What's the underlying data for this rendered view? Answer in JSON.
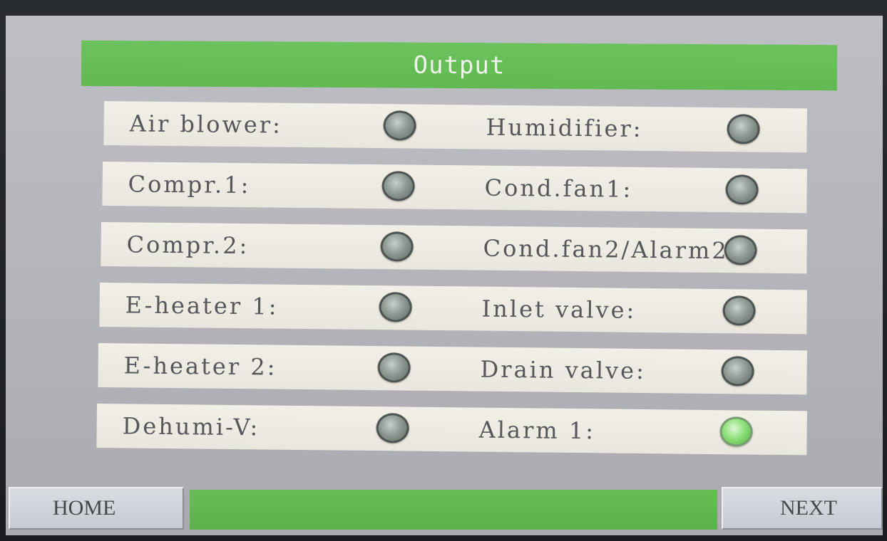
{
  "screen": {
    "title": "Output"
  },
  "rows": [
    {
      "left": {
        "label": "Air blower:",
        "on": false
      },
      "right": {
        "label": "Humidifier:",
        "on": false
      }
    },
    {
      "left": {
        "label": "Compr.1:",
        "on": false
      },
      "right": {
        "label": "Cond.fan1:",
        "on": false
      }
    },
    {
      "left": {
        "label": "Compr.2:",
        "on": false
      },
      "right": {
        "label": "Cond.fan2/Alarm2",
        "on": false
      }
    },
    {
      "left": {
        "label": "E-heater 1:",
        "on": false
      },
      "right": {
        "label": "Inlet valve:",
        "on": false
      }
    },
    {
      "left": {
        "label": "E-heater 2:",
        "on": false
      },
      "right": {
        "label": "Drain valve:",
        "on": false
      }
    },
    {
      "left": {
        "label": "Dehumi-V:",
        "on": false
      },
      "right": {
        "label": "Alarm 1:",
        "on": true
      }
    }
  ],
  "nav": {
    "home_label": "HOME",
    "next_label": "NEXT"
  },
  "colors": {
    "header_green": "#6cc25c",
    "led_off": "#8f9a94",
    "led_on": "#8ee07a"
  },
  "icons": {
    "indicator": "status-led-icon"
  }
}
